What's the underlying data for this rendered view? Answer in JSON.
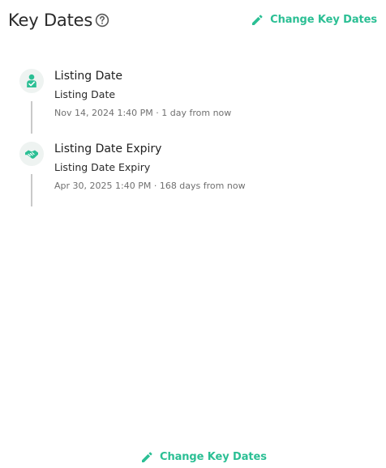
{
  "header": {
    "title": "Key Dates",
    "change_label": "Change Key Dates"
  },
  "events": [
    {
      "icon": "person-check-icon",
      "title": "Listing Date",
      "subtitle": "Listing Date",
      "meta": "Nov 14, 2024 1:40 PM · 1 day from now"
    },
    {
      "icon": "handshake-icon",
      "title": "Listing Date Expiry",
      "subtitle": "Listing Date Expiry",
      "meta": "Apr 30, 2025 1:40 PM · 168 days from now"
    }
  ],
  "footer": {
    "change_label": "Change Key Dates"
  },
  "colors": {
    "accent": "#2bbf94",
    "icon_bg": "#eef3f1",
    "connector": "#c9c9c9"
  }
}
